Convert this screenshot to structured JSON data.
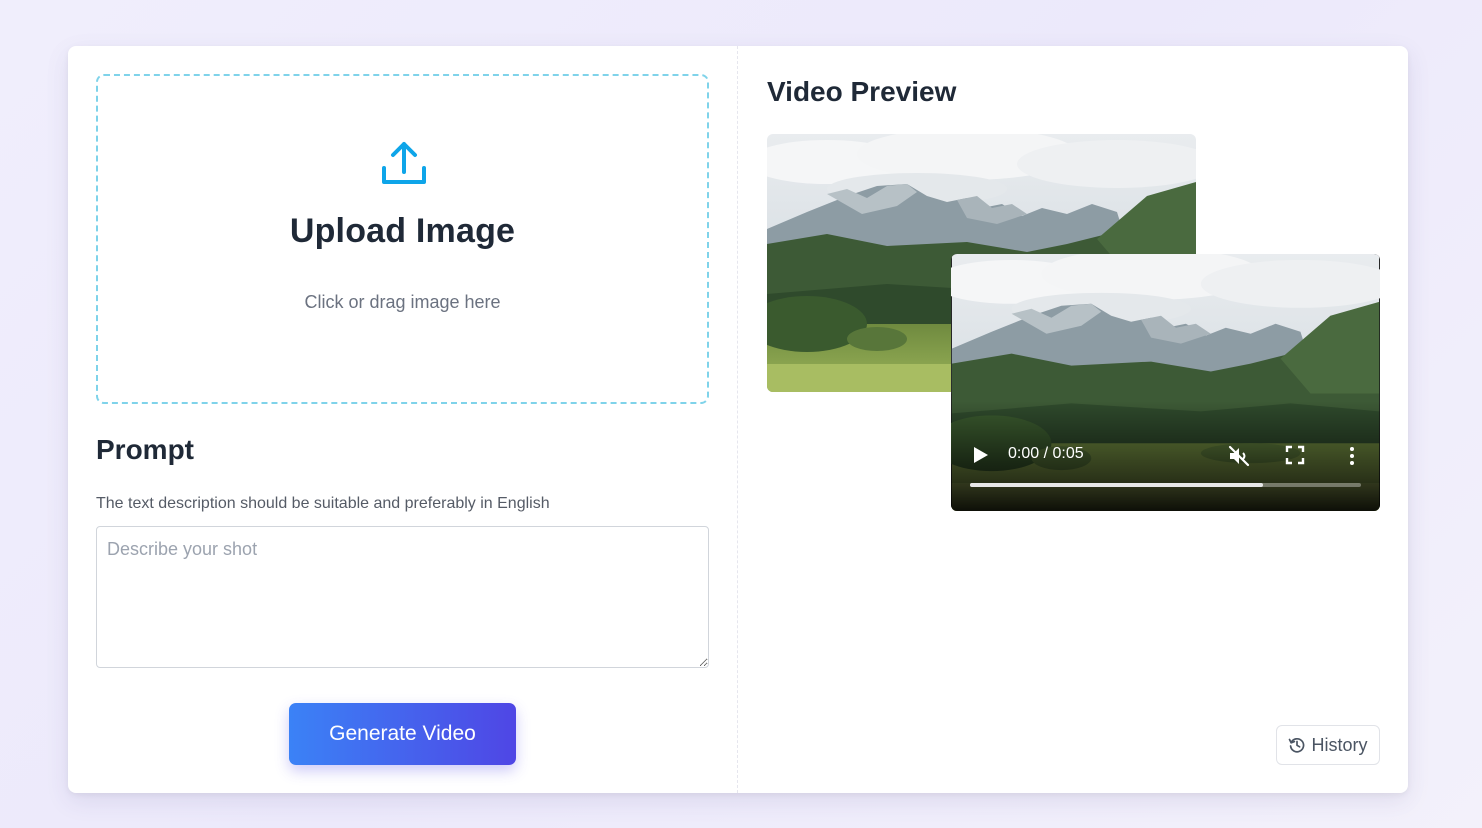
{
  "upload": {
    "title": "Upload Image",
    "hint": "Click or drag image here",
    "icon": "upload-icon"
  },
  "prompt": {
    "title": "Prompt",
    "description": "The text description should be suitable and preferably in English",
    "placeholder": "Describe your shot",
    "value": ""
  },
  "generate": {
    "label": "Generate Video"
  },
  "preview": {
    "title": "Video Preview",
    "image_icon": "mountain-landscape-image",
    "video": {
      "time": "0:00 / 0:05",
      "progress": 0.75,
      "muted": true,
      "icons": [
        "play-icon",
        "mute-icon",
        "fullscreen-icon",
        "more-vert-icon"
      ]
    }
  },
  "history": {
    "label": "History",
    "icon": "history-icon"
  },
  "colors": {
    "accent_start": "#3b82f6",
    "accent_end": "#4f46e5",
    "upload_border": "#7fd3ea",
    "upload_icon": "#0ea5e9",
    "heading": "#1f2937"
  }
}
